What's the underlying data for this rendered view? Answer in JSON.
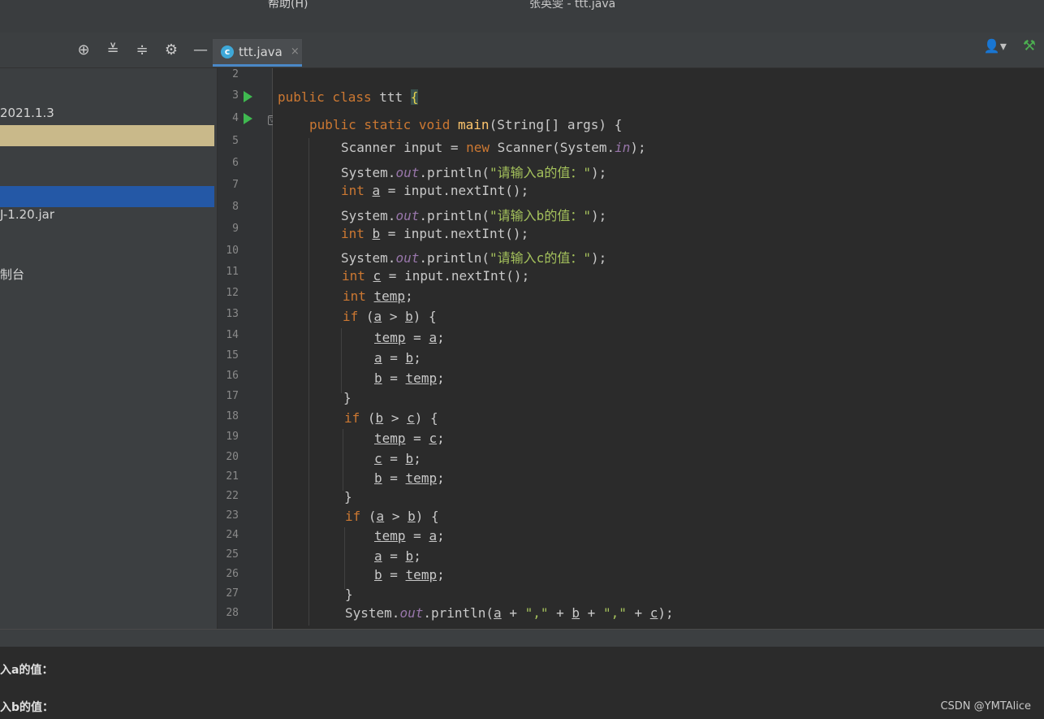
{
  "window": {
    "menu": [
      "",
      "",
      "",
      "",
      "帮助(H)"
    ],
    "title": "张英雯 - ttt.java"
  },
  "toolbar": {
    "icons": [
      "crosshair-icon",
      "expand-all-icon",
      "collapse-all-icon",
      "gear-icon",
      "minimize-icon"
    ]
  },
  "tab": {
    "label": "ttt.java",
    "close": "×"
  },
  "sidebar": {
    "items": [
      {
        "label": "2021.1.3"
      },
      {
        "label": ""
      },
      {
        "label": ""
      },
      {
        "label": "J-1.20.jar"
      },
      {
        "label": "制台"
      }
    ]
  },
  "editor": {
    "line_numbers": [
      "2",
      "3",
      "4",
      "5",
      "6",
      "7",
      "8",
      "9",
      "10",
      "11",
      "12",
      "13",
      "14",
      "15",
      "16",
      "17",
      "18",
      "19",
      "20",
      "21",
      "22",
      "23",
      "24",
      "25",
      "26",
      "27",
      "28"
    ]
  },
  "console": {
    "lines": [
      "入a的值：",
      "入b的值："
    ]
  },
  "watermark": "CSDN @YMTAlice"
}
